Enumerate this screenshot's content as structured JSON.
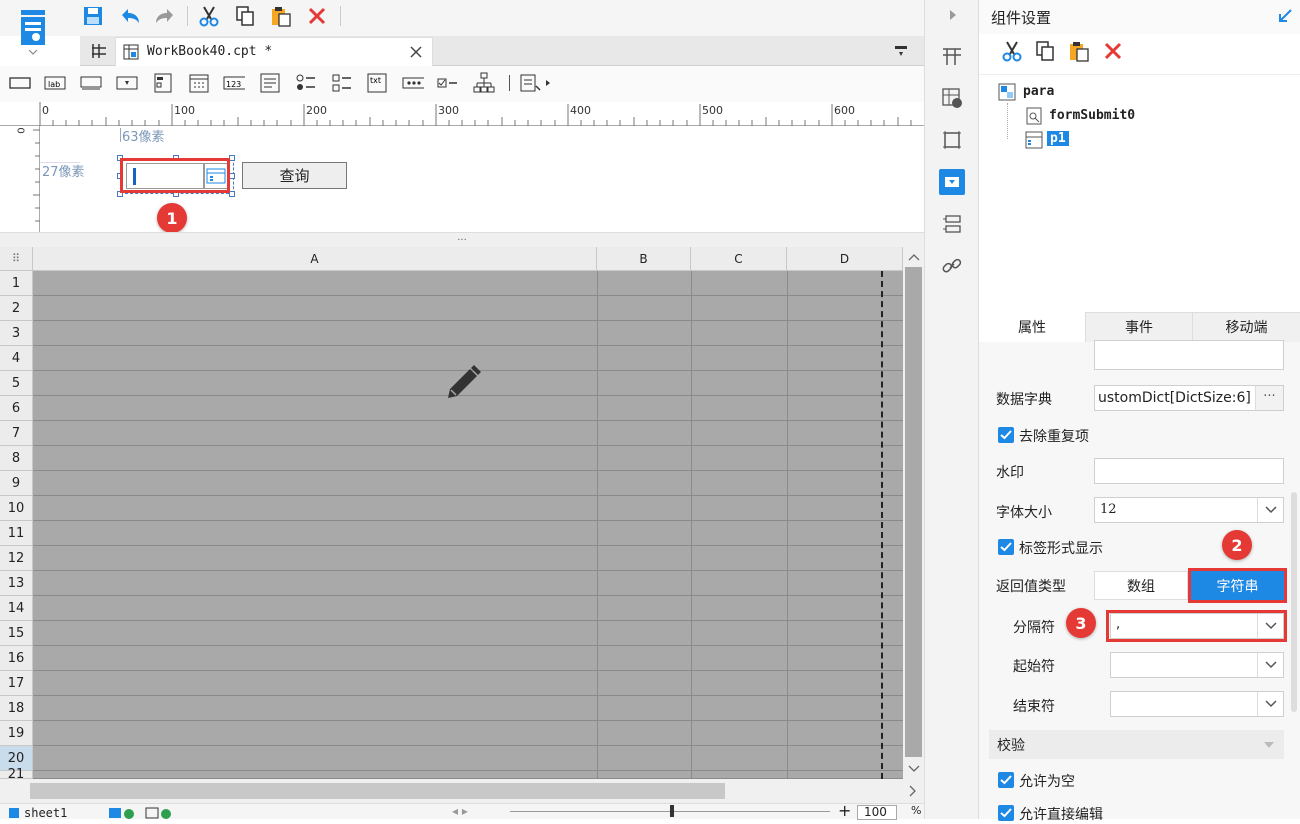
{
  "tab": {
    "filename": "WorkBook40.cpt *"
  },
  "ruler": {
    "ticks": [
      "0",
      "100",
      "200",
      "300",
      "400",
      "500",
      "600"
    ]
  },
  "canvas": {
    "width_label": "63像素",
    "height_label": "27像素",
    "query_button": "查询",
    "vertical_ruler_zero": "0"
  },
  "sheet": {
    "columns": [
      "A",
      "B",
      "C",
      "D"
    ],
    "rows": [
      "1",
      "2",
      "3",
      "4",
      "5",
      "6",
      "7",
      "8",
      "9",
      "10",
      "11",
      "12",
      "13",
      "14",
      "15",
      "16",
      "17",
      "18",
      "19",
      "20",
      "21"
    ],
    "sheet_tab": "sheet1",
    "zoom": "100",
    "zoom_unit": "%"
  },
  "panel": {
    "title": "组件设置",
    "tree": {
      "root": "para",
      "child1": "formSubmit0",
      "child2": "p1"
    },
    "tabs": [
      "属性",
      "事件",
      "移动端"
    ]
  },
  "props": {
    "dict_label": "数据字典",
    "dict_value": "ustomDict[DictSize:6]",
    "dict_more": "···",
    "dedupe_label": "去除重复项",
    "watermark_label": "水印",
    "fontsize_label": "字体大小",
    "fontsize_value": "12",
    "tagmode_label": "标签形式显示",
    "return_label": "返回值类型",
    "return_opt1": "数组",
    "return_opt2": "字符串",
    "sep_label": "分隔符",
    "sep_value": ",",
    "start_label": "起始符",
    "end_label": "结束符",
    "section_check": "校验",
    "allow_empty": "允许为空",
    "allow_edit": "允许直接编辑"
  },
  "badges": [
    "1",
    "2",
    "3"
  ],
  "colors": {
    "accent": "#1e88e5",
    "highlight": "#e53935",
    "grid": "#a9a9a9"
  }
}
